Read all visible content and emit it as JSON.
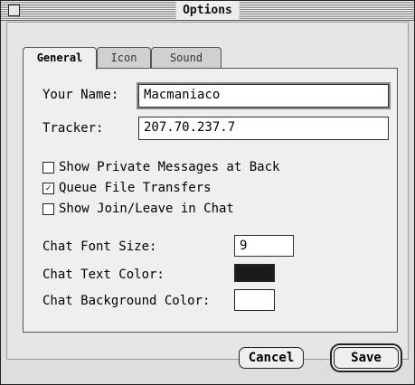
{
  "window": {
    "title": "Options"
  },
  "tabs": [
    {
      "label": "General",
      "active": true
    },
    {
      "label": "Icon",
      "active": false
    },
    {
      "label": "Sound",
      "active": false
    }
  ],
  "form": {
    "name_label": "Your Name:",
    "name_value": "Macmaniaco",
    "tracker_label": "Tracker:",
    "tracker_value": "207.70.237.7"
  },
  "checkboxes": [
    {
      "label": "Show Private Messages at Back",
      "checked": false
    },
    {
      "label": "Queue File Transfers",
      "checked": true
    },
    {
      "label": "Show Join/Leave in Chat",
      "checked": false
    }
  ],
  "chat": {
    "font_size_label": "Chat Font Size:",
    "font_size_value": "9",
    "text_color_label": "Chat Text Color:",
    "text_color": "#1a1a1a",
    "bg_color_label": "Chat Background Color:",
    "bg_color": "#ffffff"
  },
  "buttons": {
    "cancel": "Cancel",
    "save": "Save"
  }
}
